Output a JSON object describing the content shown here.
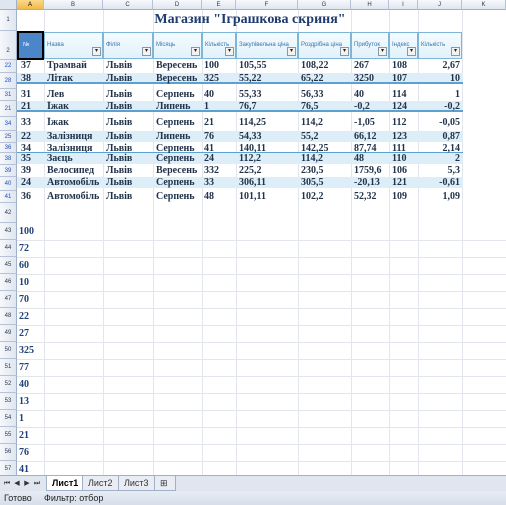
{
  "title": "Магазин \"Іграшкова скриня\"",
  "columns": [
    "A",
    "B",
    "C",
    "D",
    "E",
    "F",
    "G",
    "H",
    "I",
    "J",
    "K"
  ],
  "headers": [
    "№",
    "Назва",
    "Філія",
    "Місяць",
    "Кількість",
    "Закупівельна ціна",
    "Роздрібна ціна",
    "Прибуток",
    "Індекс",
    "Кількість"
  ],
  "row_headers_top": [
    "1",
    "2"
  ],
  "data_rows": [
    {
      "rn": "22",
      "v": [
        "37",
        "Трамвай",
        "Львів",
        "Вересень",
        "100",
        "105,55",
        "108,22",
        "267",
        "108",
        "2,67"
      ]
    },
    {
      "rn": "28",
      "v": [
        "38",
        "Літак",
        "Львів",
        "Вересень",
        "325",
        "55,22",
        "65,22",
        "3250",
        "107",
        "10"
      ]
    },
    {
      "rn": "31",
      "v": [
        "31",
        "Лев",
        "Львів",
        "Серпень",
        "40",
        "55,33",
        "56,33",
        "40",
        "114",
        "1"
      ]
    },
    {
      "rn": "21",
      "v": [
        "21",
        "Їжак",
        "Львів",
        "Липень",
        "1",
        "76,7",
        "76,5",
        "-0,2",
        "124",
        "-0,2"
      ]
    },
    {
      "rn": "34",
      "v": [
        "33",
        "Їжак",
        "Львів",
        "Серпень",
        "21",
        "114,25",
        "114,2",
        "-1,05",
        "112",
        "-0,05"
      ]
    },
    {
      "rn": "25",
      "v": [
        "22",
        "Залізниця",
        "Львів",
        "Липень",
        "76",
        "54,33",
        "55,2",
        "66,12",
        "123",
        "0,87"
      ]
    },
    {
      "rn": "36",
      "v": [
        "34",
        "Залізниця",
        "Львів",
        "Серпень",
        "41",
        "140,11",
        "142,25",
        "87,74",
        "111",
        "2,14"
      ]
    },
    {
      "rn": "38",
      "v": [
        "35",
        "Заєць",
        "Львів",
        "Серпень",
        "24",
        "112,2",
        "114,2",
        "48",
        "110",
        "2"
      ]
    },
    {
      "rn": "39",
      "v": [
        "39",
        "Велосипед",
        "Львів",
        "Вересень",
        "332",
        "225,2",
        "230,5",
        "1759,6",
        "106",
        "5,3"
      ]
    },
    {
      "rn": "40",
      "v": [
        "24",
        "Автомобіль",
        "Львів",
        "Серпень",
        "33",
        "306,11",
        "305,5",
        "-20,13",
        "121",
        "-0,61"
      ]
    },
    {
      "rn": "41",
      "v": [
        "36",
        "Автомобіль",
        "Львів",
        "Серпень",
        "48",
        "101,11",
        "102,2",
        "52,32",
        "109",
        "1,09"
      ]
    }
  ],
  "empty_rows": [
    "42"
  ],
  "lower_rows": [
    {
      "rn": "43",
      "v": "100"
    },
    {
      "rn": "44",
      "v": "72"
    },
    {
      "rn": "45",
      "v": "60"
    },
    {
      "rn": "46",
      "v": "10"
    },
    {
      "rn": "47",
      "v": "70"
    },
    {
      "rn": "48",
      "v": "22"
    },
    {
      "rn": "49",
      "v": "27"
    },
    {
      "rn": "50",
      "v": "325"
    },
    {
      "rn": "51",
      "v": "77"
    },
    {
      "rn": "52",
      "v": "40"
    },
    {
      "rn": "53",
      "v": "13"
    },
    {
      "rn": "54",
      "v": "1"
    },
    {
      "rn": "55",
      "v": "21"
    },
    {
      "rn": "56",
      "v": "76"
    },
    {
      "rn": "57",
      "v": "41"
    }
  ],
  "sheet_tabs": [
    "Лист1",
    "Лист2",
    "Лист3"
  ],
  "status": {
    "ready": "Готово",
    "filter": "Фильтр: отбор"
  }
}
